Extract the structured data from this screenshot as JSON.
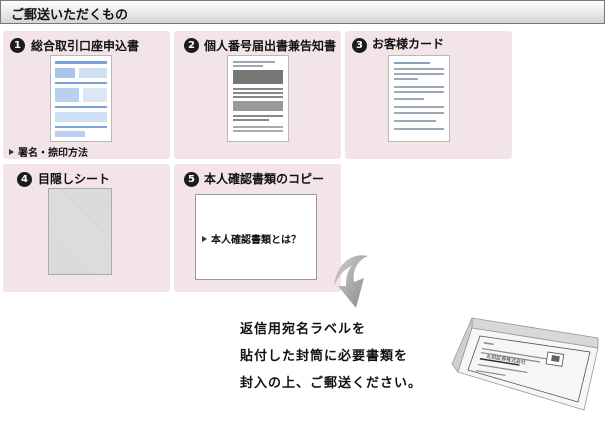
{
  "header": {
    "title": "ご郵送いただくもの"
  },
  "items": [
    {
      "num": "1",
      "title": "総合取引口座申込書",
      "link": "署名・捺印方法"
    },
    {
      "num": "2",
      "title": "個人番号届出書兼告知書"
    },
    {
      "num": "3",
      "title": "お客様カード"
    },
    {
      "num": "4",
      "title": "目隠しシート"
    },
    {
      "num": "5",
      "title": "本人確認書類のコピー",
      "link": "本人確認書類とは？"
    }
  ],
  "instruction": {
    "lines": [
      "返信用宛名ラベルを",
      "貼付した封筒に必要書類を",
      "封入の上、ご郵送ください。"
    ]
  },
  "envelope": {
    "company": "丸和証券株式会社"
  },
  "colors": {
    "card_bg": "#f3e4e8",
    "header_bg": "#e6e6e6",
    "badge": "#1c1c1c"
  }
}
